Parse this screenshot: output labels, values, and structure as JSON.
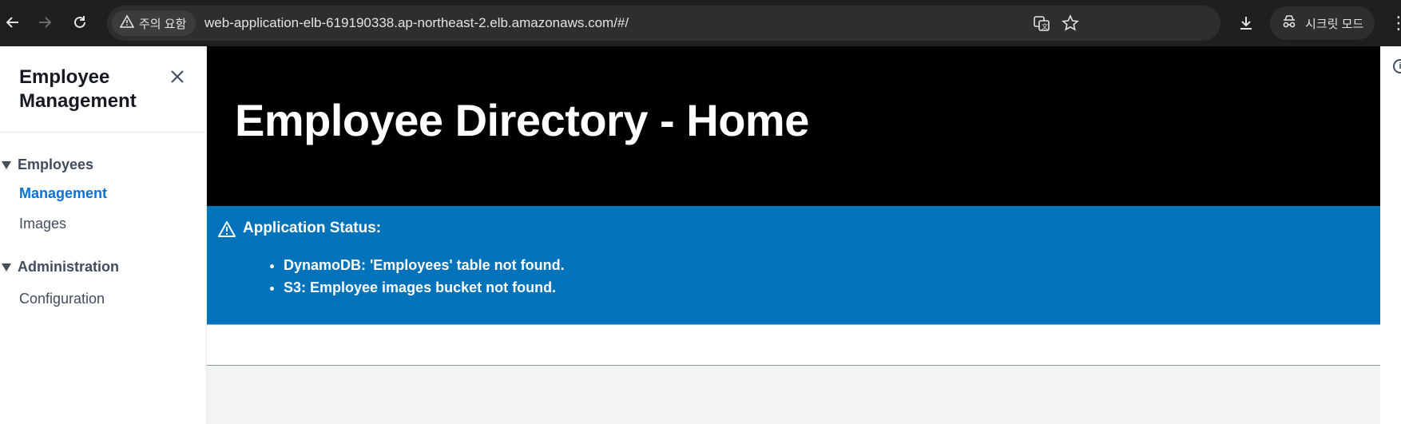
{
  "browser": {
    "security_chip": "주의 요함",
    "url": "web-application-elb-619190338.ap-northeast-2.elb.amazonaws.com/#/",
    "incognito_label": "시크릿 모드",
    "icons": [
      "back-icon",
      "forward-icon",
      "reload-icon",
      "warning-icon",
      "translate-icon",
      "star-icon",
      "download-icon",
      "incognito-icon",
      "more-icon"
    ]
  },
  "sidebar": {
    "title": "Employee Management",
    "sections": [
      {
        "label": "Employees",
        "items": [
          {
            "label": "Management",
            "active": true
          },
          {
            "label": "Images",
            "active": false
          }
        ]
      },
      {
        "label": "Administration",
        "items": [
          {
            "label": "Configuration",
            "active": false
          }
        ]
      }
    ]
  },
  "main": {
    "heading": "Employee Directory - Home",
    "alert": {
      "title": "Application Status:",
      "items": [
        "DynamoDB: 'Employees' table not found.",
        "S3: Employee images bucket not found."
      ]
    }
  },
  "colors": {
    "chrome_bg": "#1f1f1f",
    "hero_bg": "#000000",
    "alert_bg": "#0073bb",
    "active_link": "#0972d3"
  }
}
